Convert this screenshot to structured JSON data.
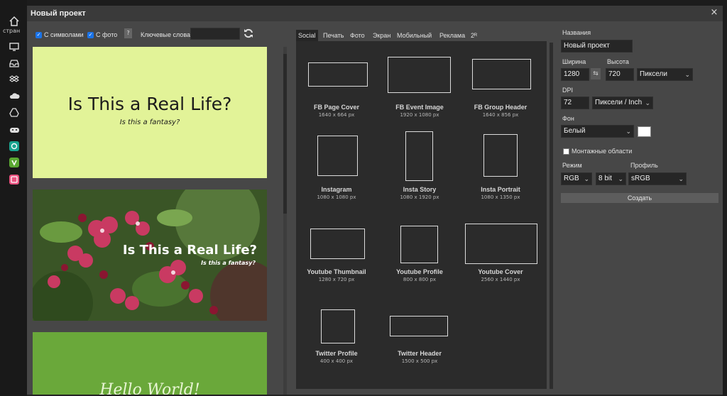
{
  "app": {
    "sidebar_home_label": "стран",
    "tools": [
      "home-icon",
      "monitor-icon",
      "inbox-icon",
      "dropbox-icon",
      "cloud-icon",
      "google-drive-icon",
      "gamepad-icon",
      "teal-app-icon",
      "green-app-icon",
      "pink-app-icon"
    ]
  },
  "dialog": {
    "title": "Новый проект",
    "close_label": "×"
  },
  "toolbar": {
    "with_text_label": "С символами",
    "with_photo_label": "С фото",
    "help_label": "?",
    "keywords_label": "Ключевые слова:",
    "keywords_value": ""
  },
  "cards": [
    {
      "title": "Is This a Real Life?",
      "subtitle": "Is this a fantasy?"
    },
    {
      "title": "Is This a Real Life?",
      "subtitle": "Is this a fantasy?"
    },
    {
      "title": "Hello World!"
    }
  ],
  "tabs": [
    "Social",
    "Печать",
    "Фото",
    "Экран",
    "Мобильный",
    "Реклама",
    "2ᴿ"
  ],
  "active_tab": "Social",
  "presets": [
    {
      "name": "FB Page Cover",
      "dims": "1640 x 664 px"
    },
    {
      "name": "FB Event Image",
      "dims": "1920 x 1080 px"
    },
    {
      "name": "FB Group Header",
      "dims": "1640 x 856 px"
    },
    {
      "name": "Instagram",
      "dims": "1080 x 1080 px"
    },
    {
      "name": "Insta Story",
      "dims": "1080 x 1920 px"
    },
    {
      "name": "Insta Portrait",
      "dims": "1080 x 1350 px"
    },
    {
      "name": "Youtube Thumbnail",
      "dims": "1280 x 720 px"
    },
    {
      "name": "Youtube Profile",
      "dims": "800 x 800 px"
    },
    {
      "name": "Youtube Cover",
      "dims": "2560 x 1440 px"
    },
    {
      "name": "Twitter Profile",
      "dims": "400 x 400 px"
    },
    {
      "name": "Twitter Header",
      "dims": "1500 x 500 px"
    }
  ],
  "form": {
    "name_label": "Названия",
    "name_value": "Новый проект",
    "width_label": "Ширина",
    "width_value": "1280",
    "swap_icon": "⇆",
    "height_label": "Высота",
    "height_value": "720",
    "unit_value": "Пиксели",
    "dpi_label": "DPI",
    "dpi_value": "72",
    "dpi_unit_value": "Пиксели / Inch",
    "bg_label": "Фон",
    "bg_value": "Белый",
    "bg_color": "#ffffff",
    "artboards_label": "Монтажные области",
    "mode_label": "Режим",
    "mode_value": "RGB",
    "bits_value": "8 bit",
    "profile_label": "Профиль",
    "profile_value": "sRGB",
    "create_label": "Создать"
  }
}
